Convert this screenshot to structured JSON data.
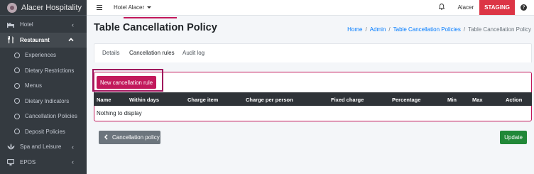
{
  "sidebar": {
    "brand": "Alacer Hospitality",
    "items": [
      {
        "label": "Hotel",
        "icon": "hotel-icon",
        "chevron": "‹"
      },
      {
        "label": "Restaurant",
        "icon": "utensils-icon",
        "chevron": "⌄"
      },
      {
        "label": "Experiences"
      },
      {
        "label": "Dietary Restrictions"
      },
      {
        "label": "Menus"
      },
      {
        "label": "Dietary Indicators"
      },
      {
        "label": "Cancellation Policies"
      },
      {
        "label": "Deposit Policies"
      },
      {
        "label": "Spa and Leisure",
        "icon": "spa-icon",
        "chevron": "‹"
      },
      {
        "label": "EPOS",
        "icon": "epos-icon",
        "chevron": "‹"
      }
    ]
  },
  "topbar": {
    "hotel_selector": "Hotel Alacer",
    "user": "Alacer",
    "env_badge": "STAGING"
  },
  "page": {
    "title": "Table Cancellation Policy",
    "breadcrumb": [
      "Home",
      "Admin",
      "Table Cancellation Policies",
      "Table Cancellation Policy"
    ]
  },
  "tabs": [
    "Details",
    "Cancellation rules",
    "Audit log"
  ],
  "actions": {
    "new_rule": "New cancellation rule",
    "back": "Cancellation policy",
    "update": "Update"
  },
  "table": {
    "columns": [
      "Name",
      "Within days",
      "Charge item",
      "Charge per person",
      "Fixed charge",
      "Percentage",
      "Min",
      "Max",
      "Action"
    ],
    "empty_text": "Nothing to display"
  },
  "colors": {
    "sidebar_bg": "#343a40",
    "accent": "#c2185b",
    "staging": "#dc3545",
    "update": "#218838",
    "back": "#6c757d",
    "table_header": "#2f3338"
  }
}
